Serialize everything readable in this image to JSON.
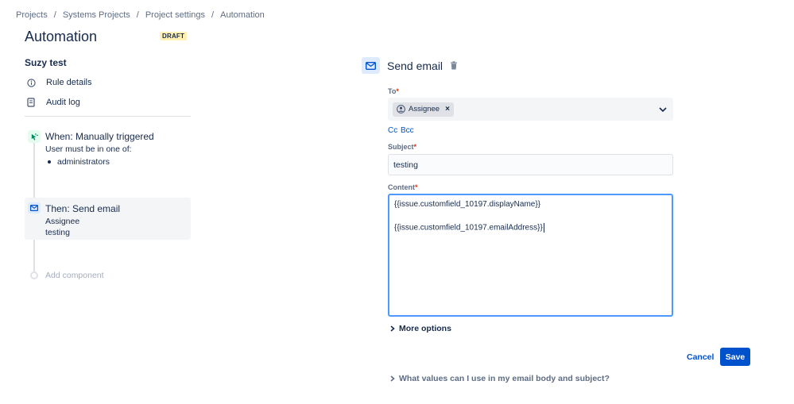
{
  "breadcrumb": [
    {
      "label": "Projects"
    },
    {
      "label": "Systems Projects"
    },
    {
      "label": "Project settings"
    },
    {
      "label": "Automation"
    }
  ],
  "breadcrumb_separator": "/",
  "page": {
    "title": "Automation",
    "badge": "DRAFT"
  },
  "sidebar": {
    "rule_name": "Suzy test",
    "nav": [
      {
        "label": "Rule details",
        "icon": "info-icon"
      },
      {
        "label": "Audit log",
        "icon": "document-icon"
      }
    ],
    "trigger": {
      "title": "When: Manually triggered",
      "subtitle": "User must be in one of:",
      "groups": [
        "administrators"
      ],
      "icon": "cursor-click-icon"
    },
    "action": {
      "title": "Then: Send email",
      "line1": "Assignee",
      "line2": "testing",
      "icon": "mail-icon"
    },
    "add_component": "Add component"
  },
  "email": {
    "title": "Send email",
    "to_label": "To",
    "required_mark": "*",
    "to_recipients": [
      {
        "label": "Assignee"
      }
    ],
    "remove_mark": "×",
    "cc_label": "Cc",
    "bcc_label": "Bcc",
    "subject_label": "Subject",
    "subject_value": "testing",
    "content_label": "Content",
    "content_lines": [
      "{{issue.customfield_10197.displayName}}",
      "{{issue.customfield_10197.emailAddress}}"
    ],
    "more_options": "More options",
    "cancel_label": "Cancel",
    "save_label": "Save",
    "help_link": "What values can I use in my email body and subject?"
  },
  "colors": {
    "primary": "#0052cc",
    "text": "#172b4d",
    "subtle_text": "#5e6c84",
    "focus_border": "#4c9aff",
    "draft_badge_bg": "#fff0b3",
    "required": "#de350b"
  }
}
